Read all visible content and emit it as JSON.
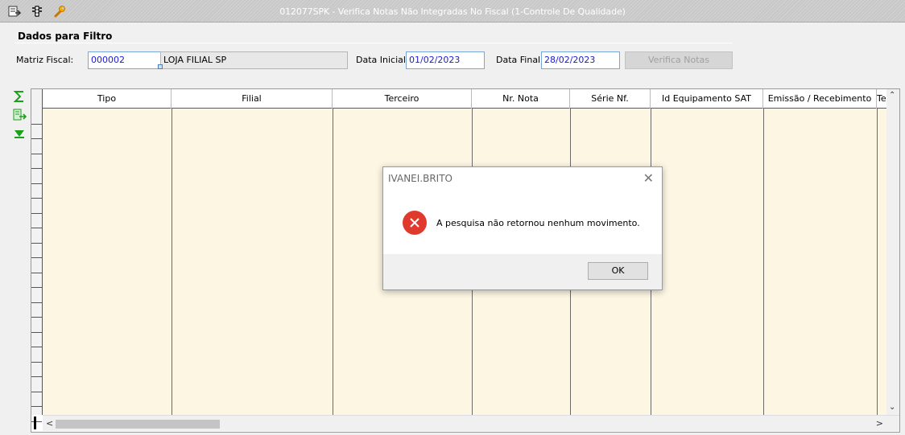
{
  "window": {
    "title": "012077SPK - Verifica Notas Não Integradas No Fiscal (1-Controle De Qualidade)",
    "icons": [
      "export-icon",
      "traffic-light-icon",
      "wrench-icon"
    ]
  },
  "filter": {
    "section_title": "Dados para Filtro",
    "matriz_label": "Matriz Fiscal:",
    "matriz_code": "000002",
    "matriz_name": "LOJA FILIAL SP",
    "data_inicial_label": "Data Inicial:",
    "data_inicial": "01/02/2023",
    "data_final_label": "Data Final:",
    "data_final": "28/02/2023",
    "verifica_button": "Verifica Notas"
  },
  "side_tools": [
    "sum-icon",
    "export-arrow-icon",
    "expand-down-icon"
  ],
  "grid": {
    "columns": [
      "Tipo",
      "Filial",
      "Terceiro",
      "Nr. Nota",
      "Série Nf.",
      "Id Equipamento SAT",
      "Emissão / Recebimento",
      "Te"
    ],
    "rows": []
  },
  "dialog": {
    "title": "IVANEI.BRITO",
    "message": "A pesquisa não retornou nenhum movimento.",
    "ok_label": "OK",
    "icon": "error-icon"
  },
  "colors": {
    "grid_body": "#fdf6e3",
    "error_red": "#e03a2f",
    "field_text": "#1a1ad0"
  }
}
